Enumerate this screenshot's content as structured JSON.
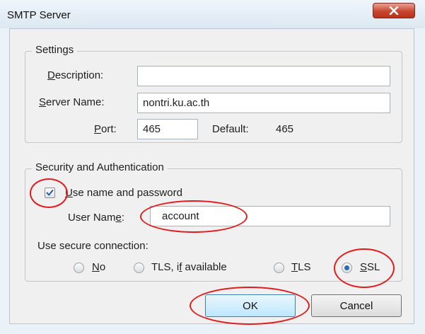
{
  "window": {
    "title": "SMTP Server"
  },
  "settings": {
    "legend": "Settings",
    "description": {
      "label_pre": "",
      "label_u": "D",
      "label_post": "escription:",
      "value": ""
    },
    "server_name": {
      "label_pre": "",
      "label_u": "S",
      "label_post": "erver Name:",
      "value": "nontri.ku.ac.th"
    },
    "port": {
      "label_pre": "",
      "label_u": "P",
      "label_post": "ort:",
      "value": "465"
    },
    "default": {
      "label": "Default:",
      "value": "465"
    }
  },
  "security": {
    "legend": "Security and Authentication",
    "use_name_password": {
      "label_pre": "",
      "label_u": "U",
      "label_post": "se name and password",
      "checked": true
    },
    "user_name": {
      "label_pre": "User Nam",
      "label_u": "e",
      "label_post": ":",
      "value": "account"
    },
    "secure_connection_label": "Use secure connection:",
    "options": [
      {
        "pre": "",
        "u": "N",
        "post": "o",
        "selected": false
      },
      {
        "pre": "TLS, i",
        "u": "f",
        "post": " available",
        "selected": false
      },
      {
        "pre": "",
        "u": "T",
        "post": "LS",
        "selected": false
      },
      {
        "pre": "",
        "u": "S",
        "post": "SL",
        "selected": true
      }
    ]
  },
  "buttons": {
    "ok": "OK",
    "cancel": "Cancel"
  },
  "colors": {
    "annotation_ring": "#e21b1b",
    "radio_selected": "#2a6bb8"
  }
}
